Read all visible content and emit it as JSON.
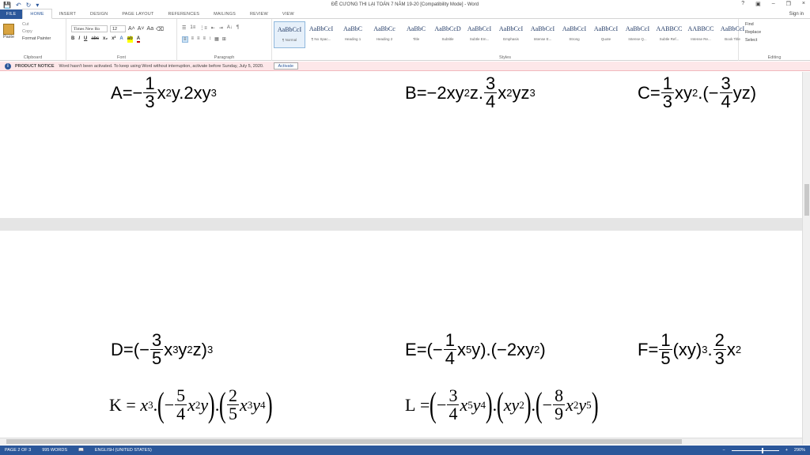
{
  "window": {
    "title": "ĐỀ CƯƠNG THI LẠI TOÁN 7 NĂM 19-20 [Compatibility Mode] - Word",
    "help": "?",
    "restore": "▣",
    "minimize": "–",
    "maximize": "❐",
    "close": "×"
  },
  "qat": {
    "save": "💾",
    "undo": "↶",
    "redo": "↻",
    "customize": "▾"
  },
  "tabs": {
    "file": "FILE",
    "home": "HOME",
    "insert": "INSERT",
    "design": "DESIGN",
    "page_layout": "PAGE LAYOUT",
    "references": "REFERENCES",
    "mailings": "MAILINGS",
    "review": "REVIEW",
    "view": "VIEW",
    "signin": "Sign in"
  },
  "ribbon": {
    "clipboard": {
      "paste": "Paste",
      "cut": "Cut",
      "copy": "Copy",
      "format_painter": "Format Painter",
      "label": "Clipboard"
    },
    "font": {
      "name": "Times New Ro",
      "size": "12",
      "grow": "A˄",
      "shrink": "A˅",
      "case": "Aa",
      "clear": "⌫",
      "bold": "B",
      "italic": "I",
      "underline": "U",
      "strike": "abc",
      "sub": "x₂",
      "sup": "x²",
      "effects": "A",
      "highlight": "ab",
      "color": "A",
      "label": "Font"
    },
    "paragraph": {
      "bullets": "☰",
      "numbering": "1≡",
      "multilevel": "⋮≡",
      "dec_indent": "⇤",
      "inc_indent": "⇥",
      "sort": "A↓",
      "show_marks": "¶",
      "align_left": "≡",
      "center": "≡",
      "align_right": "≡",
      "justify": "≡",
      "spacing": "↕",
      "shading": "▦",
      "borders": "⊞",
      "label": "Paragraph"
    },
    "styles": {
      "label": "Styles",
      "items": [
        {
          "preview": "AaBbCcI",
          "name": "¶ Normal"
        },
        {
          "preview": "AaBbCcI",
          "name": "¶ No Spac..."
        },
        {
          "preview": "AaBbC",
          "name": "Heading 1"
        },
        {
          "preview": "AaBbCc",
          "name": "Heading 2"
        },
        {
          "preview": "AaBbC",
          "name": "Title"
        },
        {
          "preview": "AaBbCcD",
          "name": "Subtitle"
        },
        {
          "preview": "AaBbCcI",
          "name": "Subtle Em..."
        },
        {
          "preview": "AaBbCcI",
          "name": "Emphasis"
        },
        {
          "preview": "AaBbCcI",
          "name": "Intense E..."
        },
        {
          "preview": "AaBbCcI",
          "name": "Strong"
        },
        {
          "preview": "AaBbCcI",
          "name": "Quote"
        },
        {
          "preview": "AaBbCcI",
          "name": "Intense Q..."
        },
        {
          "preview": "AABBCC",
          "name": "Subtle Ref..."
        },
        {
          "preview": "AABBCC",
          "name": "Intense Re..."
        },
        {
          "preview": "AaBbCcI",
          "name": "Book Title"
        }
      ]
    },
    "editing": {
      "find": "Find",
      "replace": "Replace",
      "select": "Select",
      "label": "Editing"
    }
  },
  "notice": {
    "title": "PRODUCT NOTICE",
    "message": "Word hasn't been activated. To keep using Word without interruption, activate before Sunday, July 5, 2020.",
    "button": "Activate"
  },
  "equations": {
    "A": {
      "lhs": "A",
      "eq": "=",
      "sign": "−",
      "num": "1",
      "den": "3",
      "rest_a": "x",
      "sup_a": "2",
      "rest_b": "y.2xy",
      "sup_b": "3"
    },
    "B": {
      "lhs": "B",
      "eq": "=",
      "pre": "−2xy",
      "sup_a": "2",
      "mid": "z.",
      "num": "3",
      "den": "4",
      "rest_a": "x",
      "sup_b": "2",
      "rest_b": "yz",
      "sup_c": "3"
    },
    "C": {
      "lhs": "C",
      "eq": "=",
      "num1": "1",
      "den1": "3",
      "mid_a": "xy",
      "sup_a": "2",
      "mid_b": ".(−",
      "num2": "3",
      "den2": "4",
      "tail": "yz)"
    },
    "D": {
      "lhs": "D",
      "eq": "=",
      "open": "(−",
      "num": "3",
      "den": "5",
      "rest_a": "x",
      "sup_a": "3",
      "rest_b": "y",
      "sup_b": "2",
      "rest_c": "z)",
      "sup_c": "3"
    },
    "E": {
      "lhs": "E",
      "eq": "=",
      "open": "(−",
      "num": "1",
      "den": "4",
      "rest_a": "x",
      "sup_a": "5",
      "rest_b": "y).(−2xy",
      "sup_b": "2",
      "close": ")"
    },
    "F": {
      "lhs": "F",
      "eq": "=",
      "num1": "1",
      "den1": "5",
      "mid_a": "(xy)",
      "sup_a": "3",
      "dot": ".",
      "num2": "2",
      "den2": "3",
      "tail": "x",
      "sup_b": "2"
    },
    "K": {
      "lhs": "K",
      "eq": "=",
      "base": "x",
      "sup_base": "3",
      "dot1": ".",
      "minus": "−",
      "num1": "5",
      "den1": "4",
      "t1a": "x",
      "s1a": "2",
      "t1b": "y",
      "dot2": ".",
      "num2": "2",
      "den2": "5",
      "t2a": "x",
      "s2a": "3",
      "t2b": "y",
      "s2b": "4"
    },
    "L": {
      "lhs": "L",
      "eq": "=",
      "minus1": "−",
      "num1": "3",
      "den1": "4",
      "t1a": "x",
      "s1a": "5",
      "t1b": "y",
      "s1b": "4",
      "dot1": ".",
      "t2": "xy",
      "s2": "2",
      "dot2": ".",
      "minus2": "−",
      "num3": "8",
      "den3": "9",
      "t3a": "x",
      "s3a": "2",
      "t3b": "y",
      "s3b": "5"
    }
  },
  "status": {
    "page": "PAGE 2 OF 3",
    "words": "995 WORDS",
    "proof": "📖",
    "language": "ENGLISH (UNITED STATES)",
    "zoom": "290%",
    "zoom_out": "−",
    "zoom_in": "+"
  }
}
